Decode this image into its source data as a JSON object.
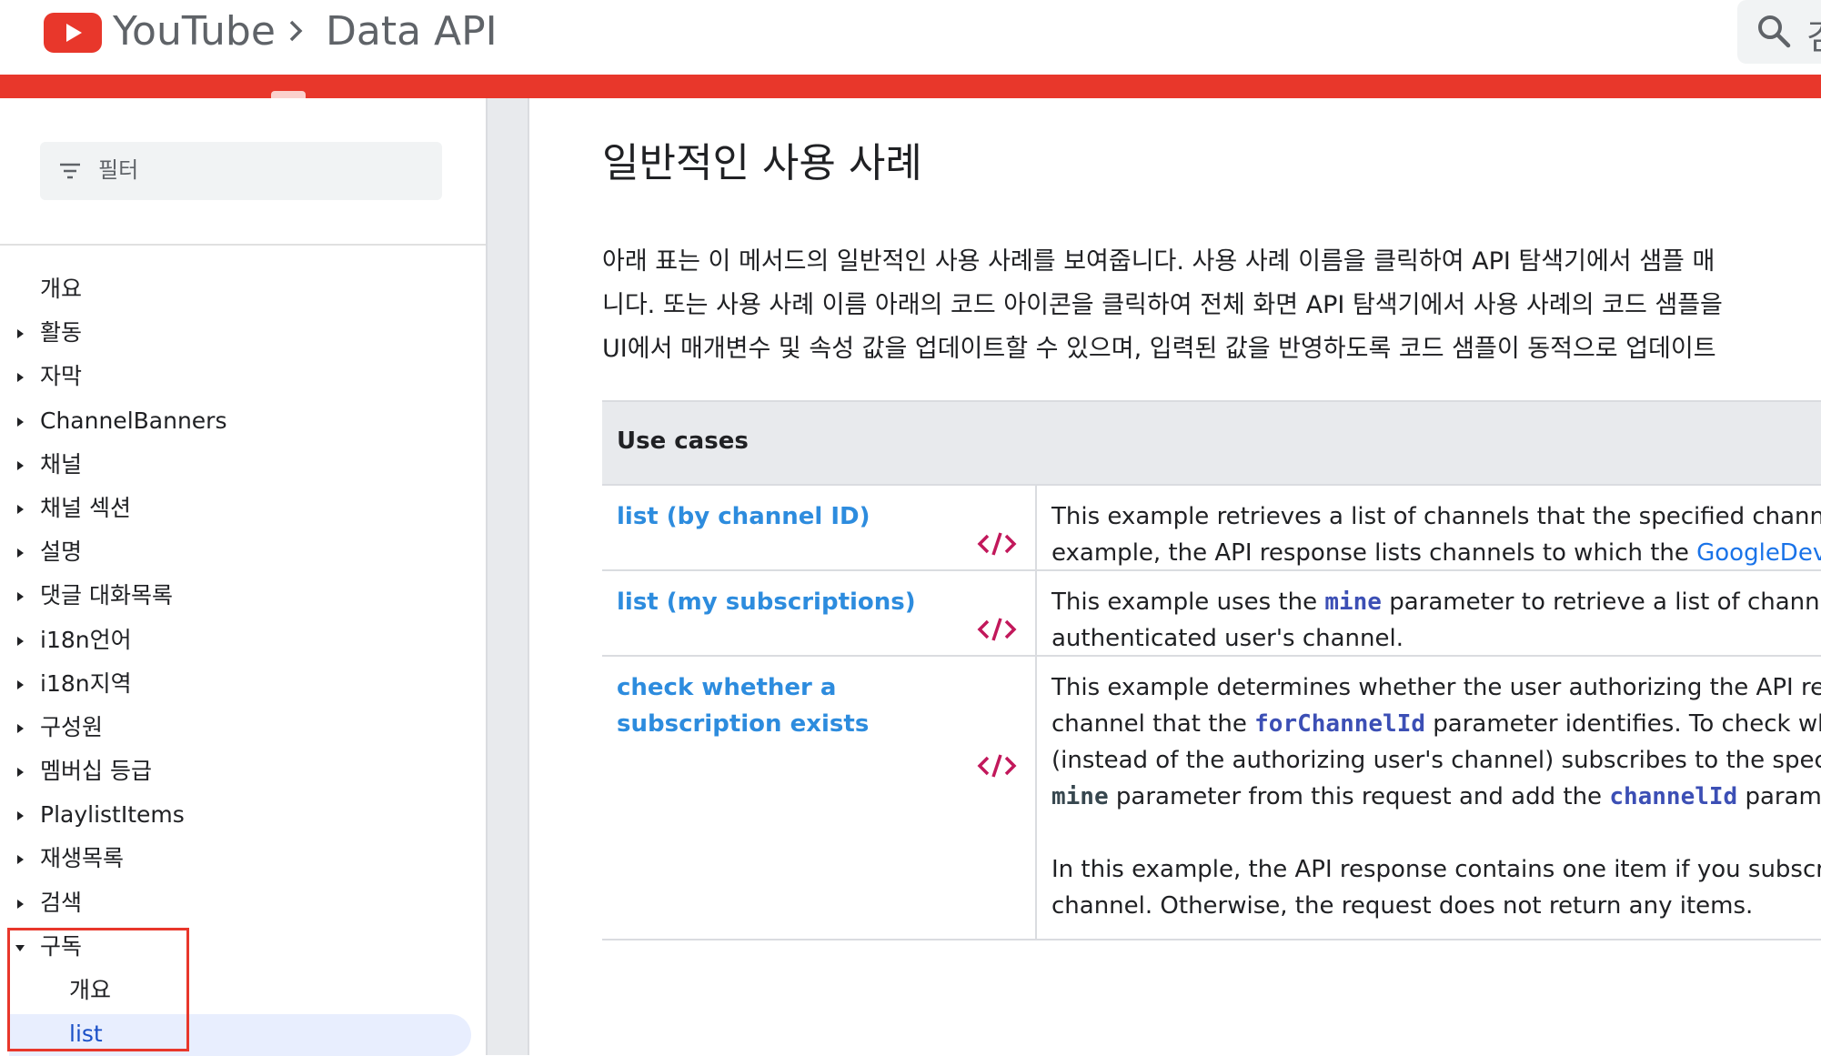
{
  "header": {
    "brand": "YouTube",
    "product": "Data API",
    "search_partial": "검",
    "accent_color": "#e8372b"
  },
  "sidebar": {
    "filter_placeholder": "필터",
    "items": [
      {
        "label": "개요",
        "caret": "none"
      },
      {
        "label": "활동",
        "caret": "right"
      },
      {
        "label": "자막",
        "caret": "right"
      },
      {
        "label": "ChannelBanners",
        "caret": "right"
      },
      {
        "label": "채널",
        "caret": "right"
      },
      {
        "label": "채널 섹션",
        "caret": "right"
      },
      {
        "label": "설명",
        "caret": "right"
      },
      {
        "label": "댓글 대화목록",
        "caret": "right"
      },
      {
        "label": "i18n언어",
        "caret": "right"
      },
      {
        "label": "i18n지역",
        "caret": "right"
      },
      {
        "label": "구성원",
        "caret": "right"
      },
      {
        "label": "멤버십 등급",
        "caret": "right"
      },
      {
        "label": "PlaylistItems",
        "caret": "right"
      },
      {
        "label": "재생목록",
        "caret": "right"
      },
      {
        "label": "검색",
        "caret": "right"
      },
      {
        "label": "구독",
        "caret": "down"
      },
      {
        "label": "개요",
        "caret": "none",
        "child": true
      },
      {
        "label": "list",
        "caret": "none",
        "child": true,
        "active": true
      }
    ]
  },
  "main": {
    "title": "일반적인 사용 사례",
    "intro_lines": [
      "아래 표는 이 메서드의 일반적인 사용 사례를 보여줍니다. 사용 사례 이름을 클릭하여 API 탐색기에서 샘플 매",
      "니다. 또는 사용 사례 이름 아래의 코드 아이콘을 클릭하여 전체 화면 API 탐색기에서 사용 사례의 코드 샘플을",
      "UI에서 매개변수 및 속성 값을 업데이트할 수 있으며, 입력된 값을 반영하도록 코드 샘플이 동적으로 업데이트"
    ],
    "table": {
      "header": "Use cases",
      "rows": [
        {
          "name": "list (by channel ID)",
          "line1": "This example retrieves a list of channels that the specified channel s",
          "line2_pre": "example, the API response lists channels to which the ",
          "line2_link": "GoogleDevelo"
        },
        {
          "name": "list (my subscriptions)",
          "line1_pre": "This example uses the ",
          "line1_code": "mine",
          "line1_post": " parameter to retrieve a list of channels t",
          "line2": "authenticated user's channel."
        },
        {
          "name": "check whether a subscription exists",
          "line1": "This example determines whether the user authorizing the API reque",
          "line2_pre": "channel that the ",
          "line2_code": "forChannelId",
          "line2_post": " parameter identifies. To check whe",
          "line3": "(instead of the authorizing user's channel) subscribes to the specifie",
          "line4_code": "mine",
          "line4_mid": " parameter from this request and add the ",
          "line4_code2": "channelId",
          "line4_post": " paramete",
          "para2_line1": "In this example, the API response contains one item if you subscribe",
          "para2_line2": "channel. Otherwise, the request does not return any items."
        }
      ]
    }
  }
}
